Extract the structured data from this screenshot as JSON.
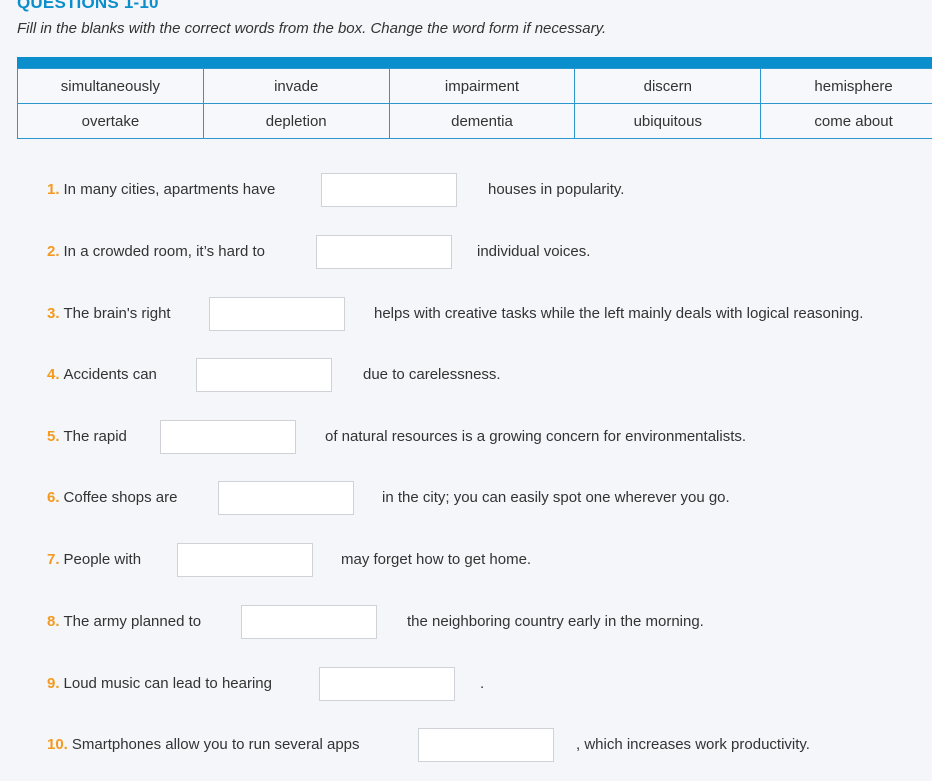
{
  "title": "QUESTIONS 1-10",
  "instruction": "Fill in the blanks with the correct words from the box. Change the word form if necessary.",
  "colors": {
    "accent": "#0a8fcc",
    "number": "#f39a1e"
  },
  "word_box": [
    [
      "simultaneously",
      "invade",
      "impairment",
      "discern",
      "hemisphere"
    ],
    [
      "overtake",
      "depletion",
      "dementia",
      "ubiquitous",
      "come about"
    ]
  ],
  "questions": [
    {
      "num": "1.",
      "before": "In many cities, apartments have",
      "after": "houses in popularity.",
      "answer": ""
    },
    {
      "num": "2.",
      "before": "In a crowded room, it’s hard to",
      "after": "individual voices.",
      "answer": ""
    },
    {
      "num": "3.",
      "before": "The brain's right",
      "after": "helps with creative tasks while the left mainly deals with logical reasoning.",
      "answer": ""
    },
    {
      "num": "4.",
      "before": "Accidents can",
      "after": "due to carelessness.",
      "answer": ""
    },
    {
      "num": "5.",
      "before": "The rapid",
      "after": "of natural resources is a growing concern for environmentalists.",
      "answer": ""
    },
    {
      "num": "6.",
      "before": "Coffee shops are",
      "after": "in the city; you can easily spot one wherever you go.",
      "answer": ""
    },
    {
      "num": "7.",
      "before": "People with",
      "after": "may forget how to get home.",
      "answer": ""
    },
    {
      "num": "8.",
      "before": "The army planned to",
      "after": "the neighboring country early in the morning.",
      "answer": ""
    },
    {
      "num": "9.",
      "before": "Loud music can lead to hearing",
      "after": ".",
      "answer": ""
    },
    {
      "num": "10.",
      "before": "Smartphones allow you to run several apps",
      "after": ", which increases work productivity.",
      "answer": ""
    }
  ]
}
